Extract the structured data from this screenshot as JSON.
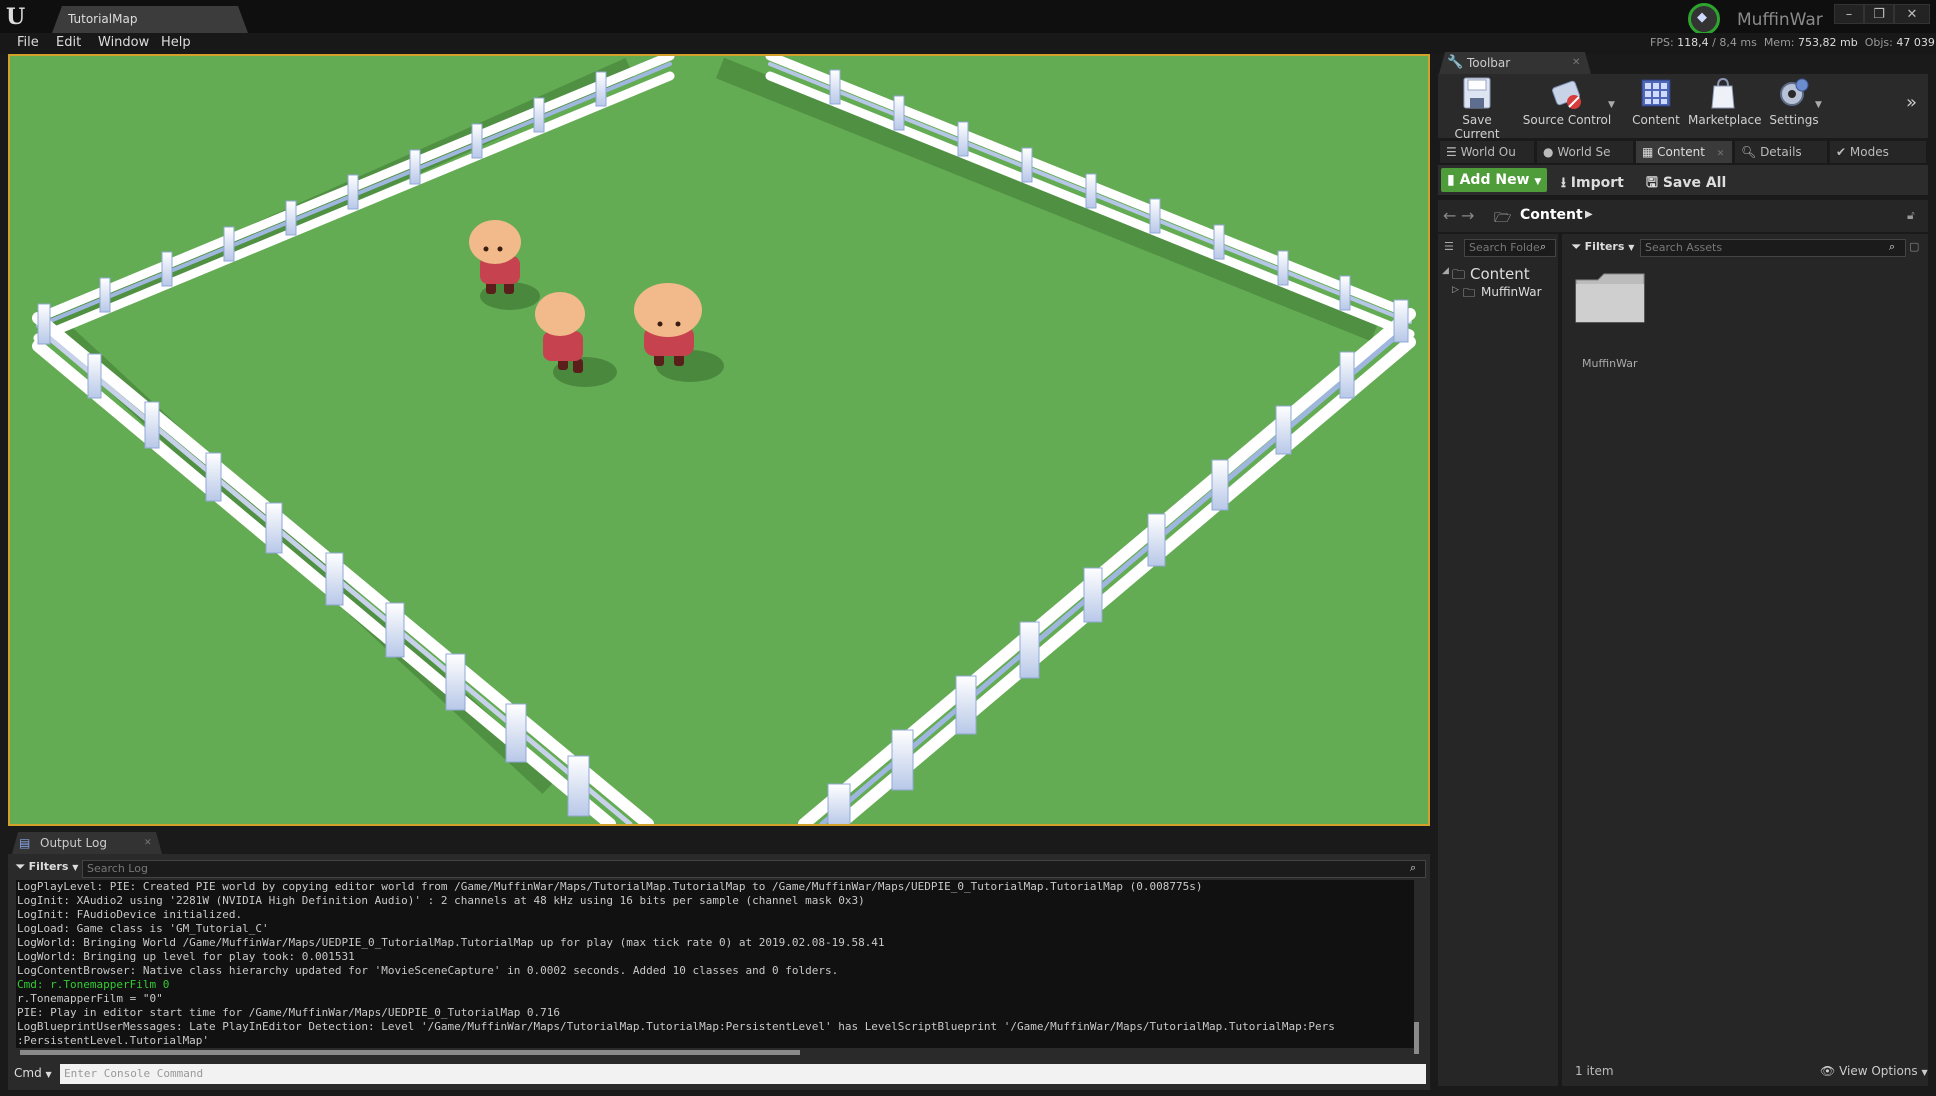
{
  "window": {
    "tab_title": "TutorialMap",
    "project_name": "MuffinWar",
    "minimize_glyph": "–",
    "maximize_glyph": "❐",
    "close_glyph": "✕"
  },
  "menu": [
    "File",
    "Edit",
    "Window",
    "Help"
  ],
  "stats": {
    "fps_label": "FPS:",
    "fps_value": "118,4",
    "ms_sep": "/",
    "ms_value": "8,4 ms",
    "mem_label": "Mem:",
    "mem_value": "753,82 mb",
    "objs_label": "Objs:",
    "objs_value": "47 039"
  },
  "toolbar": {
    "tab_label": "Toolbar",
    "buttons": [
      "Save Current",
      "Source Control",
      "Content",
      "Marketplace",
      "Settings"
    ]
  },
  "panel_tabs": [
    "World Ou",
    "World Se",
    "Content",
    "Details",
    "Modes"
  ],
  "content_browser": {
    "add_new": "Add New",
    "import": "Import",
    "save_all": "Save All",
    "path_root": "Content",
    "search_folders_placeholder": "Search Folde",
    "filters_label": "Filters",
    "search_assets_placeholder": "Search Assets",
    "tree": [
      {
        "label": "Content"
      },
      {
        "label": "MuffinWar"
      }
    ],
    "assets": [
      {
        "name": "MuffinWar"
      }
    ],
    "item_count": "1 item",
    "view_options": "View Options"
  },
  "output_log": {
    "tab_label": "Output Log",
    "filters_label": "Filters",
    "search_placeholder": "Search Log",
    "lines": [
      {
        "text": "LogPlayLevel: PIE: Created PIE world by copying editor world from /Game/MuffinWar/Maps/TutorialMap.TutorialMap to /Game/MuffinWar/Maps/UEDPIE_0_TutorialMap.TutorialMap (0.008775s)",
        "type": "normal"
      },
      {
        "text": "LogInit: XAudio2 using '2281W (NVIDIA High Definition Audio)' : 2 channels at 48 kHz using 16 bits per sample (channel mask 0x3)",
        "type": "normal"
      },
      {
        "text": "LogInit: FAudioDevice initialized.",
        "type": "normal"
      },
      {
        "text": "LogLoad: Game class is 'GM_Tutorial_C'",
        "type": "normal"
      },
      {
        "text": "LogWorld: Bringing World /Game/MuffinWar/Maps/UEDPIE_0_TutorialMap.TutorialMap up for play (max tick rate 0) at 2019.02.08-19.58.41",
        "type": "normal"
      },
      {
        "text": "LogWorld: Bringing up level for play took: 0.001531",
        "type": "normal"
      },
      {
        "text": "LogContentBrowser: Native class hierarchy updated for 'MovieSceneCapture' in 0.0002 seconds. Added 10 classes and 0 folders.",
        "type": "normal"
      },
      {
        "text": "Cmd: r.TonemapperFilm 0",
        "type": "cmd"
      },
      {
        "text": "r.TonemapperFilm = \"0\"",
        "type": "normal"
      },
      {
        "text": "PIE: Play in editor start time for /Game/MuffinWar/Maps/UEDPIE_0_TutorialMap 0.716",
        "type": "normal"
      },
      {
        "text": "LogBlueprintUserMessages: Late PlayInEditor Detection: Level '/Game/MuffinWar/Maps/TutorialMap.TutorialMap:PersistentLevel' has LevelScriptBlueprint '/Game/MuffinWar/Maps/TutorialMap.TutorialMap:Pers",
        "type": "normal"
      },
      {
        "text": ":PersistentLevel.TutorialMap'",
        "type": "normal"
      }
    ],
    "cmd_label": "Cmd",
    "cmd_placeholder": "Enter Console Command"
  },
  "colors": {
    "viewport_green": "#64ac53",
    "viewport_border": "#d3a12a",
    "add_new_green": "#4f9c3b",
    "cmd_text": "#33cc33"
  }
}
